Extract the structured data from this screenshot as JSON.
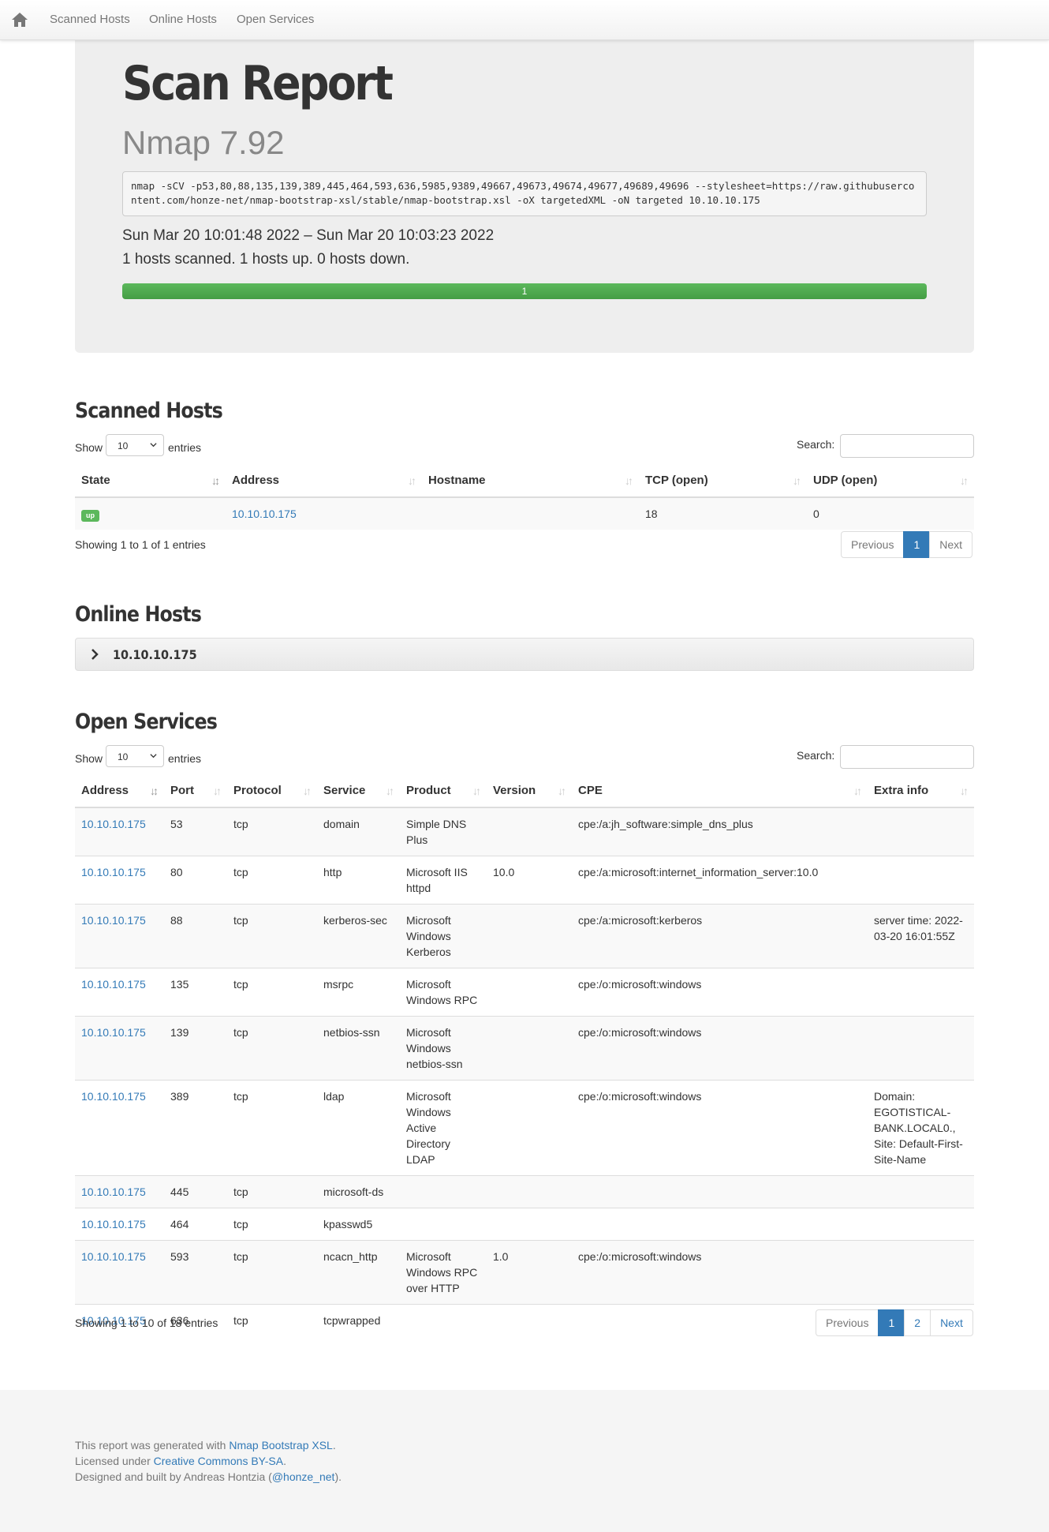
{
  "nav": {
    "items": [
      "Scanned Hosts",
      "Online Hosts",
      "Open Services"
    ]
  },
  "report": {
    "title": "Scan Report",
    "version": "Nmap 7.92",
    "command": "nmap -sCV -p53,80,88,135,139,389,445,464,593,636,5985,9389,49667,49673,49674,49677,49689,49696 --stylesheet=https://raw.githubusercontent.com/honze-net/nmap-bootstrap-xsl/stable/nmap-bootstrap.xsl -oX targetedXML -oN targeted 10.10.10.175",
    "time_range": "Sun Mar 20 10:01:48 2022 – Sun Mar 20 10:03:23 2022",
    "summary": "1 hosts scanned. 1 hosts up. 0 hosts down.",
    "progress_label": "1",
    "progress_fraction": 1.0
  },
  "scanned_hosts": {
    "title": "Scanned Hosts",
    "show_label": "Show",
    "entries_label": "entries",
    "page_length": "10",
    "search_label": "Search:",
    "columns": [
      "State",
      "Address",
      "Hostname",
      "TCP (open)",
      "UDP (open)"
    ],
    "rows": [
      {
        "state": "up",
        "address": "10.10.10.175",
        "hostname": "",
        "tcp": "18",
        "udp": "0"
      }
    ],
    "info": "Showing 1 to 1 of 1 entries",
    "pagination": [
      "Previous",
      "1",
      "Next"
    ]
  },
  "online_hosts": {
    "title": "Online Hosts",
    "host": "10.10.10.175"
  },
  "open_services": {
    "title": "Open Services",
    "show_label": "Show",
    "entries_label": "entries",
    "page_length": "10",
    "search_label": "Search:",
    "columns": [
      "Address",
      "Port",
      "Protocol",
      "Service",
      "Product",
      "Version",
      "CPE",
      "Extra info"
    ],
    "rows": [
      {
        "address": "10.10.10.175",
        "port": "53",
        "protocol": "tcp",
        "service": "domain",
        "product": "Simple DNS Plus",
        "version": "",
        "cpe": "cpe:/a:jh_software:simple_dns_plus",
        "extra": ""
      },
      {
        "address": "10.10.10.175",
        "port": "80",
        "protocol": "tcp",
        "service": "http",
        "product": "Microsoft IIS httpd",
        "version": "10.0",
        "cpe": "cpe:/a:microsoft:internet_information_server:10.0",
        "extra": ""
      },
      {
        "address": "10.10.10.175",
        "port": "88",
        "protocol": "tcp",
        "service": "kerberos-sec",
        "product": "Microsoft Windows Kerberos",
        "version": "",
        "cpe": "cpe:/a:microsoft:kerberos",
        "extra": "server time: 2022-03-20 16:01:55Z"
      },
      {
        "address": "10.10.10.175",
        "port": "135",
        "protocol": "tcp",
        "service": "msrpc",
        "product": "Microsoft Windows RPC",
        "version": "",
        "cpe": "cpe:/o:microsoft:windows",
        "extra": ""
      },
      {
        "address": "10.10.10.175",
        "port": "139",
        "protocol": "tcp",
        "service": "netbios-ssn",
        "product": "Microsoft Windows netbios-ssn",
        "version": "",
        "cpe": "cpe:/o:microsoft:windows",
        "extra": ""
      },
      {
        "address": "10.10.10.175",
        "port": "389",
        "protocol": "tcp",
        "service": "ldap",
        "product": "Microsoft Windows Active Directory LDAP",
        "version": "",
        "cpe": "cpe:/o:microsoft:windows",
        "extra": "Domain: EGOTISTICAL-BANK.LOCAL0., Site: Default-First-Site-Name"
      },
      {
        "address": "10.10.10.175",
        "port": "445",
        "protocol": "tcp",
        "service": "microsoft-ds",
        "product": "",
        "version": "",
        "cpe": "",
        "extra": ""
      },
      {
        "address": "10.10.10.175",
        "port": "464",
        "protocol": "tcp",
        "service": "kpasswd5",
        "product": "",
        "version": "",
        "cpe": "",
        "extra": ""
      },
      {
        "address": "10.10.10.175",
        "port": "593",
        "protocol": "tcp",
        "service": "ncacn_http",
        "product": "Microsoft Windows RPC over HTTP",
        "version": "1.0",
        "cpe": "cpe:/o:microsoft:windows",
        "extra": ""
      },
      {
        "address": "10.10.10.175",
        "port": "636",
        "protocol": "tcp",
        "service": "tcpwrapped",
        "product": "",
        "version": "",
        "cpe": "",
        "extra": ""
      }
    ],
    "info": "Showing 1 to 10 of 18 entries",
    "pagination": [
      "Previous",
      "1",
      "2",
      "Next"
    ]
  },
  "footer": {
    "line1_prefix": "This report was generated with ",
    "line1_link": "Nmap Bootstrap XSL",
    "line1_suffix": ".",
    "line2_prefix": "Licensed under ",
    "line2_link": "Creative Commons BY-SA",
    "line2_suffix": ".",
    "line3_prefix": "Designed and built by Andreas Hontzia (",
    "line3_link": "@honze_net",
    "line3_suffix": ")."
  },
  "colors": {
    "link": "#337ab7",
    "success": "#5cb85c",
    "jumbotron_bg": "#eeeeee"
  },
  "icons": {
    "home": "home-icon",
    "chevron": "chevron-right-icon",
    "select": "chevron-down-icon",
    "sort": "sort-icon"
  }
}
